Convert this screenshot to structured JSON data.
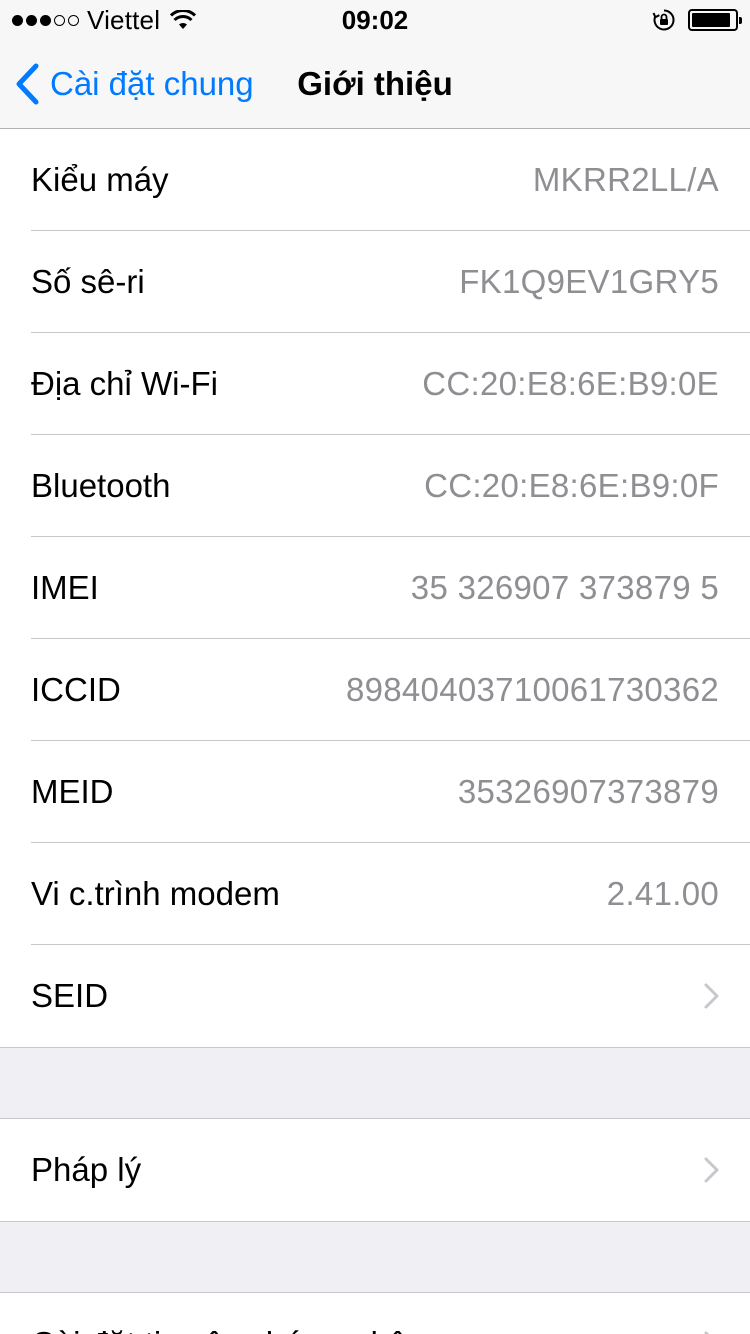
{
  "status_bar": {
    "carrier": "Viettel",
    "time": "09:02",
    "signal_bars": 3,
    "signal_total": 5,
    "battery_level": 0.9
  },
  "nav": {
    "back_label": "Cài đặt chung",
    "title": "Giới thiệu"
  },
  "info_rows": [
    {
      "label": "Kiểu máy",
      "value": "MKRR2LL/A"
    },
    {
      "label": "Số sê-ri",
      "value": "FK1Q9EV1GRY5"
    },
    {
      "label": "Địa chỉ Wi-Fi",
      "value": "CC:20:E8:6E:B9:0E"
    },
    {
      "label": "Bluetooth",
      "value": "CC:20:E8:6E:B9:0F"
    },
    {
      "label": "IMEI",
      "value": "35 326907 373879 5"
    },
    {
      "label": "ICCID",
      "value": "8984040371006173036​2"
    },
    {
      "label": "MEID",
      "value": "35326907373879"
    },
    {
      "label": "Vi c.trình modem",
      "value": "2.41.00"
    },
    {
      "label": "SEID",
      "value": ""
    }
  ],
  "legal_row": {
    "label": "Pháp lý"
  },
  "cert_row": {
    "label": "Cài đặt tin cậy chứng nhận"
  },
  "colors": {
    "accent": "#007aff",
    "secondary_text": "#8e8e93",
    "background": "#efeff4"
  }
}
